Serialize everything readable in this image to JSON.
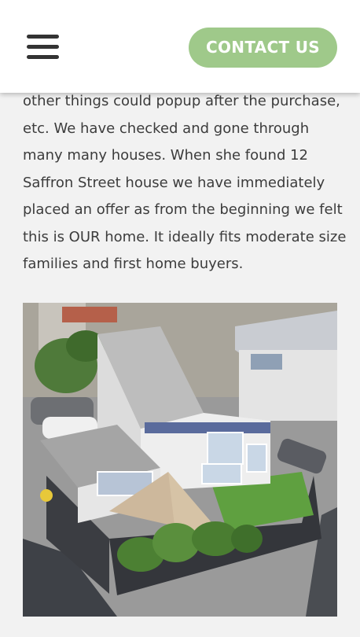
{
  "header": {
    "menu_icon": "hamburger-menu-icon",
    "contact_label": "CONTACT US"
  },
  "article": {
    "lines": [
      "other things could popup after the purchase,",
      "etc. We have checked and gone through",
      "many many houses. When she found 12",
      "Saffron Street house we have immediately",
      "placed an offer as from the beginning we felt",
      "this is OUR home. It ideally fits moderate size",
      "families and first home buyers."
    ]
  },
  "colors": {
    "accent": "#9fc98a",
    "text": "#3c3c3c",
    "background": "#f2f2f2"
  }
}
